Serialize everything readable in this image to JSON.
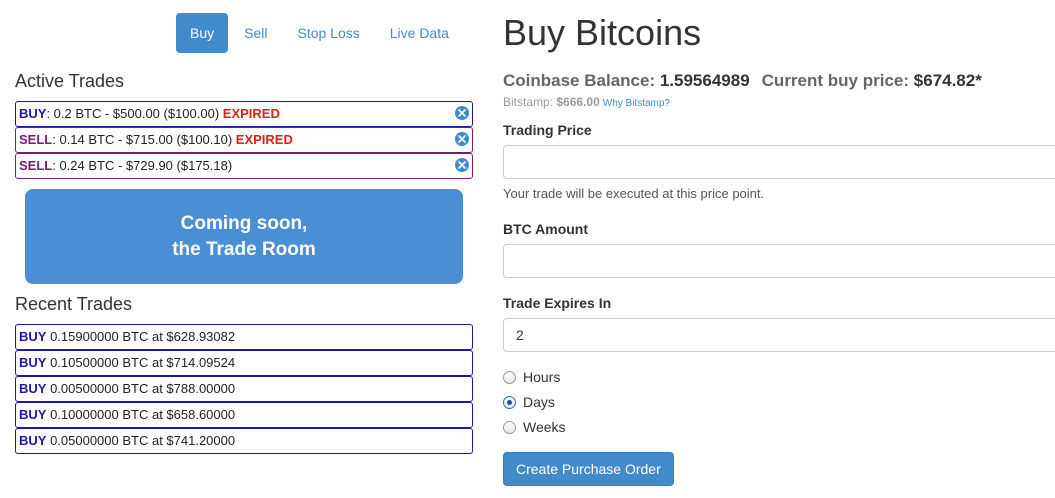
{
  "nav": {
    "tabs": [
      {
        "label": "Buy",
        "active": true
      },
      {
        "label": "Sell",
        "active": false
      },
      {
        "label": "Stop Loss",
        "active": false
      },
      {
        "label": "Live Data",
        "active": false
      }
    ]
  },
  "active_trades": {
    "title": "Active Trades",
    "items": [
      {
        "kind": "BUY",
        "detail": ": 0.2 BTC - $500.00 ($100.00) ",
        "status": "EXPIRED"
      },
      {
        "kind": "SELL",
        "detail": ": 0.14 BTC - $715.00 ($100.10) ",
        "status": "EXPIRED"
      },
      {
        "kind": "SELL",
        "detail": ": 0.24 BTC - $729.90 ($175.18)",
        "status": ""
      }
    ]
  },
  "trade_room": {
    "line1": "Coming soon,",
    "line2": "the Trade Room"
  },
  "recent_trades": {
    "title": "Recent Trades",
    "items": [
      {
        "kind": "BUY",
        "detail": " 0.15900000 BTC at $628.93082"
      },
      {
        "kind": "BUY",
        "detail": " 0.10500000 BTC at $714.09524"
      },
      {
        "kind": "BUY",
        "detail": " 0.00500000 BTC at $788.00000"
      },
      {
        "kind": "BUY",
        "detail": " 0.10000000 BTC at $658.60000"
      },
      {
        "kind": "BUY",
        "detail": " 0.05000000 BTC at $741.20000"
      }
    ]
  },
  "form": {
    "title": "Buy Bitcoins",
    "balance_label": "Coinbase Balance: ",
    "balance_value": "1.59564989",
    "price_label": "Current buy price: ",
    "price_value": "$674.82*",
    "bitstamp_label": "Bitstamp: ",
    "bitstamp_value": "$666.00",
    "bitstamp_link": "Why Bitstamp?",
    "trading_price_label": "Trading Price",
    "trading_price_value": "",
    "trading_price_help": "Your trade will be executed at this price point.",
    "btc_amount_label": "BTC Amount",
    "btc_amount_value": "",
    "expires_label": "Trade Expires In",
    "expires_value": "2",
    "units": [
      {
        "label": "Hours",
        "checked": false
      },
      {
        "label": "Days",
        "checked": true
      },
      {
        "label": "Weeks",
        "checked": false
      }
    ],
    "submit_label": "Create Purchase Order"
  },
  "colors": {
    "accent": "#428bca",
    "buy": "#1a1aa6",
    "sell": "#7a1a7a",
    "expired": "#e21d1d"
  }
}
